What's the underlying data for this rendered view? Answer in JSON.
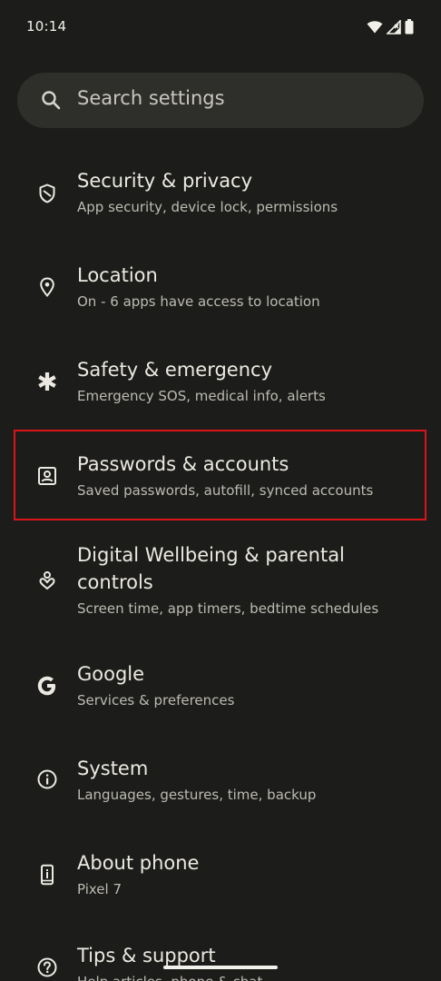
{
  "status_bar": {
    "time": "10:14",
    "icons": [
      "wifi-icon",
      "signal-icon",
      "battery-icon"
    ]
  },
  "search": {
    "placeholder": "Search settings",
    "icon": "search-icon"
  },
  "settings": [
    {
      "title": "Security & privacy",
      "subtitle": "App security, device lock, permissions",
      "icon": "shield-icon"
    },
    {
      "title": "Location",
      "subtitle": "On - 6 apps have access to location",
      "icon": "location-pin-icon"
    },
    {
      "title": "Safety & emergency",
      "subtitle": "Emergency SOS, medical info, alerts",
      "icon": "asterisk-icon"
    },
    {
      "title": "Passwords & accounts",
      "subtitle": "Saved passwords, autofill, synced accounts",
      "icon": "account-box-icon",
      "highlighted": true
    },
    {
      "title": "Digital Wellbeing & parental controls",
      "subtitle": "Screen time, app timers, bedtime schedules",
      "icon": "wellbeing-icon"
    },
    {
      "title": "Google",
      "subtitle": "Services & preferences",
      "icon": "google-icon"
    },
    {
      "title": "System",
      "subtitle": "Languages, gestures, time, backup",
      "icon": "info-icon"
    },
    {
      "title": "About phone",
      "subtitle": "Pixel 7",
      "icon": "phone-icon"
    },
    {
      "title": "Tips & support",
      "subtitle": "Help articles, phone & chat",
      "icon": "help-icon"
    }
  ],
  "colors": {
    "background": "#1c1d1a",
    "search_background": "#2e2f2b",
    "highlight": "#d9141a"
  }
}
